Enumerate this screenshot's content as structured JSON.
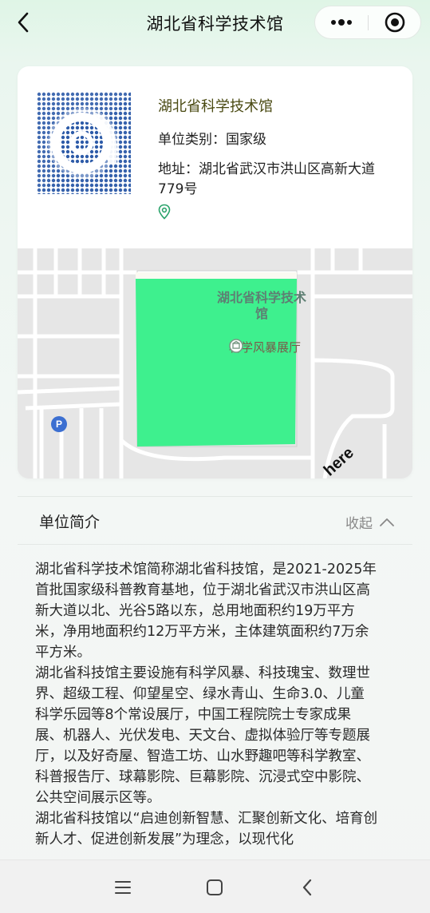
{
  "header": {
    "title": "湖北省科学技术馆",
    "back_icon": "chevron-left-icon",
    "more_icon": "more-dots-icon",
    "close_icon": "target-circle-icon"
  },
  "org": {
    "name": "湖北省科学技术馆",
    "category": "单位类别：国家级",
    "address": "地址：湖北省武汉市洪山区高新大道779号",
    "location_icon": "map-pin-icon"
  },
  "map": {
    "building_label": "湖北省科学技术馆",
    "hall_label": "科学风暴展厅",
    "parking_label": "P",
    "provider": "here",
    "highlight_color": "#3ef08e"
  },
  "intro": {
    "title": "单位简介",
    "collapse_label": "收起",
    "paragraphs": [
      "湖北省科学技术馆简称湖北省科技馆，是2021-2025年首批国家级科普教育基地，位于湖北省武汉市洪山区高新大道以北、光谷5路以东，总用地面积约19万平方米，净用地面积约12万平方米，主体建筑面积约7万余平方米。",
      "湖北省科技馆主要设施有科学风暴、科技瑰宝、数理世界、超级工程、仰望星空、绿水青山、生命3.0、儿童科学乐园等8个常设展厅，中国工程院院士专家成果展、机器人、光伏发电、天文台、虚拟体验厅等专题展厅，以及好奇屋、智造工坊、山水野趣吧等科学教室、科普报告厅、球幕影院、巨幕影院、沉浸式空中影院、公共空间展示区等。",
      "湖北省科技馆以“启迪创新智慧、汇聚创新文化、培育创新人才、促进创新发展”为理念，以现代化"
    ]
  },
  "navbar": {
    "menu_icon": "menu-icon",
    "home_icon": "home-square-icon",
    "back_icon": "back-triangle-icon"
  }
}
